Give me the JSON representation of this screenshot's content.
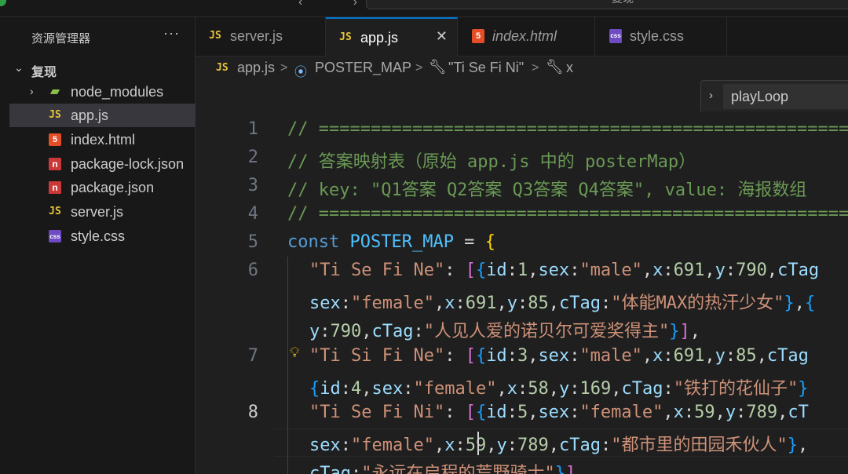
{
  "titlebar": {
    "nav_arrows": "‹ ›",
    "search_text": "复现"
  },
  "sidebar": {
    "title": "资源管理器",
    "more": "···",
    "root_folder": "复现",
    "items": [
      {
        "label": "node_modules",
        "icon": "folder-icon",
        "type": "folder"
      },
      {
        "label": "app.js",
        "icon": "js-file-icon",
        "type": "js",
        "selected": true
      },
      {
        "label": "index.html",
        "icon": "html-file-icon",
        "type": "html"
      },
      {
        "label": "package-lock.json",
        "icon": "npm-file-icon",
        "type": "npm"
      },
      {
        "label": "package.json",
        "icon": "npm-file-icon",
        "type": "npm"
      },
      {
        "label": "server.js",
        "icon": "js-file-icon",
        "type": "js"
      },
      {
        "label": "style.css",
        "icon": "css-file-icon",
        "type": "css"
      }
    ]
  },
  "tabs": [
    {
      "label": "server.js",
      "icon_text": "JS",
      "active": false
    },
    {
      "label": "app.js",
      "icon_text": "JS",
      "active": true,
      "close": "✕"
    },
    {
      "label": "index.html",
      "icon_text": "5",
      "active": false,
      "italic": true
    },
    {
      "label": "style.css",
      "icon_text": "css",
      "active": false
    }
  ],
  "breadcrumb": {
    "file_icon": "JS",
    "file": "app.js",
    "symbol1": "POSTER_MAP",
    "symbol2": "\"Ti Se Fi Ni\"",
    "symbol3": "x",
    "separator": ">"
  },
  "sticky_scroll": {
    "label": "playLoop"
  },
  "editor": {
    "line_numbers": [
      "1",
      "2",
      "3",
      "4",
      "5",
      "6",
      "7",
      "8"
    ],
    "current_line": "8"
  },
  "colors": {
    "accent": "#0078d4",
    "comment": "#6a9955",
    "keyword": "#569cd6",
    "string": "#ce9178",
    "property": "#9cdcfe"
  }
}
